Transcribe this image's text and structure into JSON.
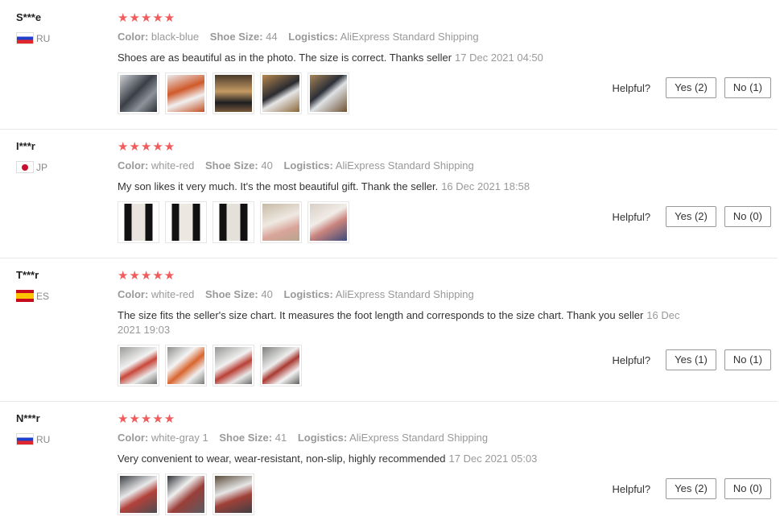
{
  "labels": {
    "color": "Color:",
    "shoe_size": "Shoe Size:",
    "logistics": "Logistics:",
    "helpful": "Helpful?"
  },
  "stars": "★★★★★",
  "reviews": [
    {
      "user": "S***e",
      "country": "RU",
      "flag": "ru",
      "color": "black-blue",
      "shoe_size": "44",
      "logistics": "AliExpress Standard Shipping",
      "text": "Shoes are as beautiful as in the photo. The size is correct. Thanks seller",
      "date": "17 Dec 2021 04:50",
      "yes": "Yes (2)",
      "no": "No (1)",
      "photos": [
        {
          "bg": "linear-gradient(135deg,#cfd2d6 0%,#3a3f47 45%,#8d939b 70%,#2b2f35 100%)"
        },
        {
          "bg": "linear-gradient(160deg,#e9ecef 0%,#d05a2a 40%,#f0f0f0 65%,#c24e22 100%)"
        },
        {
          "bg": "linear-gradient(180deg,#4a3a2c 0%,#c59a63 45%,#1e1e22 75%,#7a5a3a 100%)"
        },
        {
          "bg": "linear-gradient(150deg,#b7884f 0%,#2a2c31 45%,#e6e6e6 60%,#8a6638 100%)"
        },
        {
          "bg": "linear-gradient(140deg,#a98556 0%,#2c3038 40%,#dfe2e5 55%,#6e5233 100%)"
        }
      ]
    },
    {
      "user": "I***r",
      "country": "JP",
      "flag": "jp",
      "color": "white-red",
      "shoe_size": "40",
      "logistics": "AliExpress Standard Shipping",
      "text": "My son likes it very much. It's the most beautiful gift. Thank the seller.",
      "date": "16 Dec 2021 18:58",
      "yes": "Yes (2)",
      "no": "No (0)",
      "photos": [
        {
          "bg": "linear-gradient(90deg,#fff 0 12%,#111 12% 32%,#e8e3dc 32% 68%,#111 68% 88%,#fff 88%)"
        },
        {
          "bg": "linear-gradient(90deg,#fff 0 12%,#111 12% 32%,#ece7e1 32% 68%,#111 68% 88%,#fff 88%)"
        },
        {
          "bg": "linear-gradient(90deg,#fff 0 12%,#111 12% 32%,#e4e0da 32% 68%,#111 68% 88%,#fff 88%)"
        },
        {
          "bg": "linear-gradient(160deg,#c7b9a6 0%,#efe9e2 45%,#d9a49a 70%,#b7a48e 100%)"
        },
        {
          "bg": "linear-gradient(150deg,#d8cfc6 0%,#f1ece7 40%,#c9847d 60%,#3c4b7a 100%)"
        }
      ]
    },
    {
      "user": "T***r",
      "country": "ES",
      "flag": "es",
      "color": "white-red",
      "shoe_size": "40",
      "logistics": "AliExpress Standard Shipping",
      "text": "The size fits the seller's size chart. It measures the foot length and corresponds to the size chart. Thank you seller",
      "date": "16 Dec 2021 19:03",
      "yes": "Yes (1)",
      "no": "No (1)",
      "photos": [
        {
          "bg": "linear-gradient(150deg,#9a9a98 0%,#f2f2f2 40%,#c8473a 55%,#e9e9e9 75%,#6f6f6d 100%)"
        },
        {
          "bg": "linear-gradient(140deg,#8e8e8c 0%,#f4f4f4 35%,#d9652e 55%,#efefef 75%,#7a7a78 100%)"
        },
        {
          "bg": "linear-gradient(150deg,#959593 0%,#f1f1f1 40%,#b94036 58%,#e7e7e7 78%,#6b6b69 100%)"
        },
        {
          "bg": "linear-gradient(145deg,#7e7e7c 0%,#ededed 40%,#a93a32 55%,#f3f3f3 75%,#5f5f5d 100%)"
        }
      ]
    },
    {
      "user": "N***r",
      "country": "RU",
      "flag": "ru",
      "color": "white-gray 1",
      "shoe_size": "41",
      "logistics": "AliExpress Standard Shipping",
      "text": "Very convenient to wear, wear-resistant, non-slip, highly recommended",
      "date": "17 Dec 2021 05:03",
      "yes": "Yes (2)",
      "no": "No (0)",
      "photos": [
        {
          "bg": "linear-gradient(150deg,#3b3e44 0%,#e9e9ea 40%,#b3413a 60%,#4a4d52 100%)"
        },
        {
          "bg": "linear-gradient(140deg,#2e3136 0%,#efefef 35%,#9a3e38 58%,#595c61 100%)"
        },
        {
          "bg": "linear-gradient(160deg,#5a4a38 0%,#e6e6e6 40%,#a04038 62%,#3e3f44 100%)"
        }
      ]
    }
  ]
}
